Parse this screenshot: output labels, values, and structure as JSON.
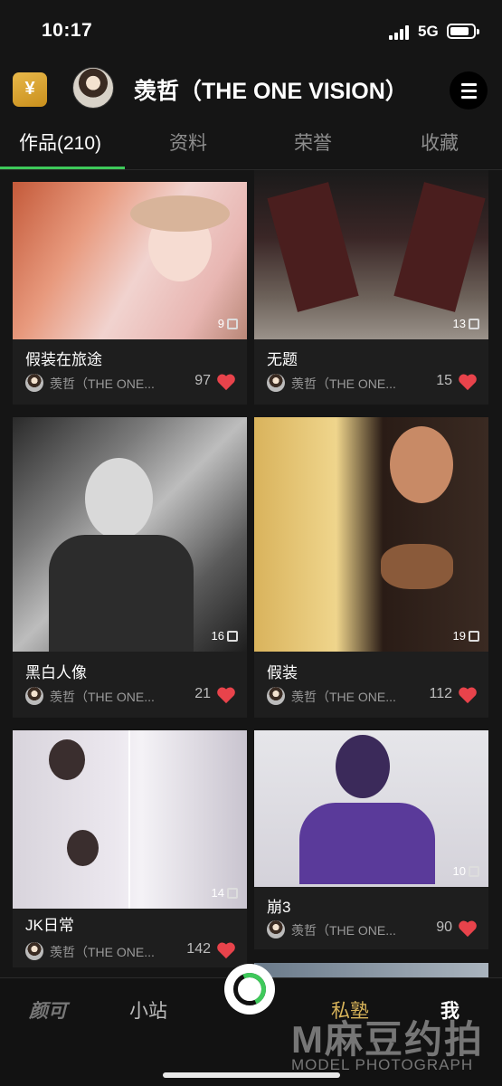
{
  "status_bar": {
    "time": "10:17",
    "network": "5G"
  },
  "header": {
    "wallet_icon": "yuan-wallet-icon",
    "wallet_glyph": "¥",
    "user_name": "羡哲（THE ONE VISION）",
    "menu_icon": "hamburger-menu-icon"
  },
  "tabs": [
    {
      "label": "作品(210)",
      "active": true
    },
    {
      "label": "资料",
      "active": false
    },
    {
      "label": "荣誉",
      "active": false
    },
    {
      "label": "收藏",
      "active": false
    }
  ],
  "posts": [
    {
      "title": "假装在旅途",
      "count": "9",
      "author": "羡哲（THE ONE...",
      "likes": "97"
    },
    {
      "title": "无题",
      "count": "13",
      "author": "羡哲（THE ONE...",
      "likes": "15"
    },
    {
      "title": "黑白人像",
      "count": "16",
      "author": "羡哲（THE ONE...",
      "likes": "21"
    },
    {
      "title": "假装",
      "count": "19",
      "author": "羡哲（THE ONE...",
      "likes": "112"
    },
    {
      "title": "JK日常",
      "count": "14",
      "author": "羡哲（THE ONE...",
      "likes": "142"
    },
    {
      "title": "崩3",
      "count": "10",
      "author": "羡哲（THE ONE...",
      "likes": "90"
    }
  ],
  "bottom_nav": {
    "items": [
      "颜可",
      "小站",
      "私塾",
      "我"
    ],
    "camera_icon": "camera-record-icon"
  },
  "watermark": {
    "logo": "M麻豆约拍",
    "subtitle": "MODEL PHOTOGRAPH"
  },
  "colors": {
    "accent": "#3ec95a",
    "heart": "#e8434b",
    "background": "#151515"
  }
}
